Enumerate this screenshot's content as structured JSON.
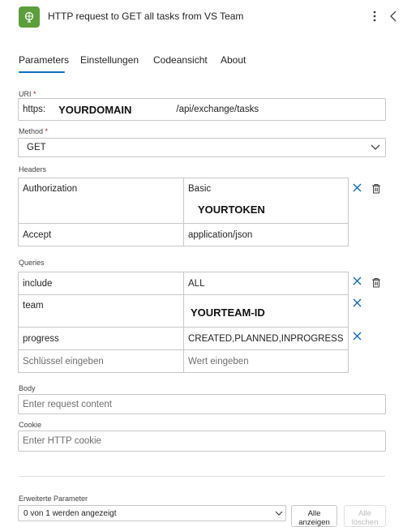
{
  "header": {
    "title": "HTTP request to GET all tasks from VS Team",
    "app_icon": "globe-icon",
    "accent_color": "#5c9e3c"
  },
  "tabs": [
    {
      "label": "Parameters",
      "active": true
    },
    {
      "label": "Einstellungen",
      "active": false
    },
    {
      "label": "Codeansicht",
      "active": false
    },
    {
      "label": "About",
      "active": false
    }
  ],
  "uri": {
    "label": "URI",
    "required_mark": "*",
    "value_prefix": "https:",
    "redacted": "YOURDOMAIN",
    "value_suffix": "/api/exchange/tasks"
  },
  "method": {
    "label": "Method",
    "required_mark": "*",
    "value": "GET"
  },
  "headers": {
    "label": "Headers",
    "rows": [
      {
        "key": "Authorization",
        "value": "Basic",
        "redacted": "YOURTOKEN"
      },
      {
        "key": "Accept",
        "value": "application/json"
      }
    ]
  },
  "queries": {
    "label": "Queries",
    "rows": [
      {
        "key": "include",
        "value": "ALL"
      },
      {
        "key": "team",
        "redacted": "YOURTEAM-ID"
      },
      {
        "key": "progress",
        "value": "CREATED,PLANNED,INPROGRESS"
      }
    ],
    "key_placeholder": "Schlüssel eingeben",
    "value_placeholder": "Wert eingeben"
  },
  "body": {
    "label": "Body",
    "placeholder": "Enter request content"
  },
  "cookie": {
    "label": "Cookie",
    "placeholder": "Enter HTTP cookie"
  },
  "advanced": {
    "label": "Erweiterte Parameter",
    "select_value": "0 von 1 werden angezeigt",
    "show_all_line1": "Alle",
    "show_all_line2": "anzeigen",
    "clear_all_line1": "Alle",
    "clear_all_line2": "löschen"
  }
}
